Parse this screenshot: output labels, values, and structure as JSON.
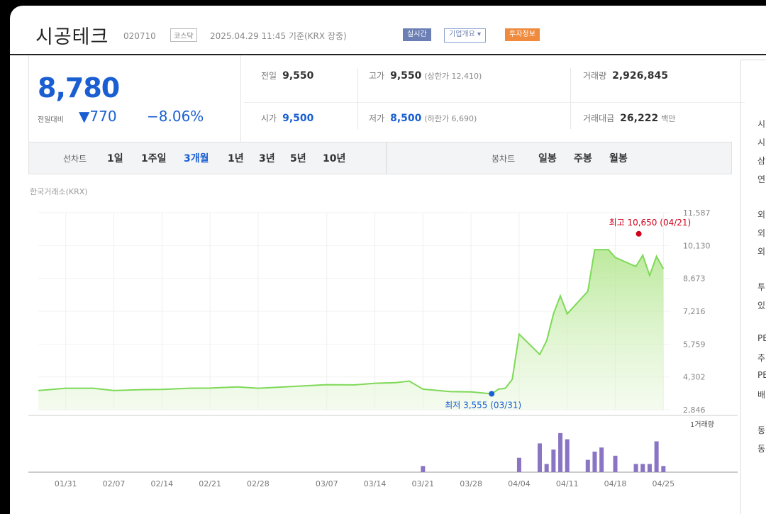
{
  "header": {
    "company_name": "시공테크",
    "stock_code": "020710",
    "market": "코스닥",
    "timestamp": "2025.04.29 11:45 기준(KRX 장중)",
    "badges": [
      "실시간",
      "기업개요 ▾",
      "투자정보"
    ]
  },
  "price": {
    "current": "8,780",
    "change_label": "전일대비",
    "change": "▼770",
    "change_pct": "−8.06%"
  },
  "stats": {
    "prev_close_label": "전일",
    "prev_close": "9,550",
    "high_label": "고가",
    "high": "9,550",
    "upper_limit": "(상한가 12,410)",
    "volume_label": "거래량",
    "volume": "2,926,845",
    "open_label": "시가",
    "open": "9,500",
    "low_label": "저가",
    "low": "8,500",
    "lower_limit": "(하한가 6,690)",
    "trade_value_label": "거래대금",
    "trade_value": "26,222",
    "trade_value_unit": "백만"
  },
  "period_tabs": {
    "line_chart_label": "선차트",
    "items": [
      "1일",
      "1주일",
      "3개월",
      "1년",
      "3년",
      "5년",
      "10년"
    ],
    "active": "3개월",
    "candle_label": "봉차트",
    "candle_items": [
      "일봉",
      "주봉",
      "월봉"
    ]
  },
  "source_label": "한국거래소(KRX)",
  "colors": {
    "up": "#d0021b",
    "down": "#1a5fd2",
    "line": "#7ed957",
    "volume": "#8a74c4"
  },
  "chart_data": {
    "type": "area",
    "x_ticks": [
      "01/31",
      "02/07",
      "02/14",
      "02/21",
      "02/28",
      "03/07",
      "03/14",
      "03/21",
      "03/28",
      "04/04",
      "04/11",
      "04/18",
      "04/25"
    ],
    "y_ticks": [
      "11,587",
      "10,130",
      "8,673",
      "7,216",
      "5,759",
      "4,302",
      "2,846"
    ],
    "ylim": [
      2846,
      11587
    ],
    "points": [
      {
        "x": "01/27",
        "y": 3700
      },
      {
        "x": "01/31",
        "y": 3800
      },
      {
        "x": "02/04",
        "y": 3800
      },
      {
        "x": "02/07",
        "y": 3700
      },
      {
        "x": "02/11",
        "y": 3740
      },
      {
        "x": "02/14",
        "y": 3750
      },
      {
        "x": "02/18",
        "y": 3800
      },
      {
        "x": "02/21",
        "y": 3810
      },
      {
        "x": "02/25",
        "y": 3860
      },
      {
        "x": "02/28",
        "y": 3800
      },
      {
        "x": "03/04",
        "y": 3910
      },
      {
        "x": "03/07",
        "y": 3960
      },
      {
        "x": "03/11",
        "y": 3950
      },
      {
        "x": "03/14",
        "y": 4020
      },
      {
        "x": "03/17",
        "y": 4050
      },
      {
        "x": "03/19",
        "y": 4120
      },
      {
        "x": "03/21",
        "y": 3760
      },
      {
        "x": "03/25",
        "y": 3650
      },
      {
        "x": "03/28",
        "y": 3640
      },
      {
        "x": "03/31",
        "y": 3555
      },
      {
        "x": "04/01",
        "y": 3760
      },
      {
        "x": "04/02",
        "y": 3800
      },
      {
        "x": "04/03",
        "y": 4200
      },
      {
        "x": "04/04",
        "y": 6200
      },
      {
        "x": "04/07",
        "y": 5300
      },
      {
        "x": "04/08",
        "y": 5900
      },
      {
        "x": "04/09",
        "y": 7100
      },
      {
        "x": "04/10",
        "y": 7900
      },
      {
        "x": "04/11",
        "y": 7100
      },
      {
        "x": "04/14",
        "y": 8100
      },
      {
        "x": "04/15",
        "y": 9950
      },
      {
        "x": "04/16",
        "y": 9950
      },
      {
        "x": "04/17",
        "y": 9950
      },
      {
        "x": "04/18",
        "y": 9600
      },
      {
        "x": "04/21",
        "y": 9200
      },
      {
        "x": "04/22",
        "y": 9700
      },
      {
        "x": "04/23",
        "y": 8800
      },
      {
        "x": "04/24",
        "y": 9650
      },
      {
        "x": "04/25",
        "y": 9100
      }
    ],
    "high_label": "최고 10,650 (04/21)",
    "low_label": "최저 3,555 (03/31)",
    "volume_label": "1거래량",
    "volume": [
      {
        "x": "03/21",
        "v": 0.15
      },
      {
        "x": "04/04",
        "v": 0.35
      },
      {
        "x": "04/07",
        "v": 0.7
      },
      {
        "x": "04/08",
        "v": 0.2
      },
      {
        "x": "04/09",
        "v": 0.55
      },
      {
        "x": "04/10",
        "v": 0.95
      },
      {
        "x": "04/11",
        "v": 0.8
      },
      {
        "x": "04/14",
        "v": 0.3
      },
      {
        "x": "04/15",
        "v": 0.5
      },
      {
        "x": "04/16",
        "v": 0.6
      },
      {
        "x": "04/18",
        "v": 0.4
      },
      {
        "x": "04/21",
        "v": 0.2
      },
      {
        "x": "04/22",
        "v": 0.2
      },
      {
        "x": "04/23",
        "v": 0.2
      },
      {
        "x": "04/24",
        "v": 0.75
      },
      {
        "x": "04/25",
        "v": 0.15
      }
    ]
  },
  "right_panel": [
    "시",
    "시",
    "삼",
    "연",
    "외",
    "외",
    "외",
    "투",
    "있",
    "PE",
    "추",
    "PE",
    "배",
    "동",
    "동"
  ]
}
